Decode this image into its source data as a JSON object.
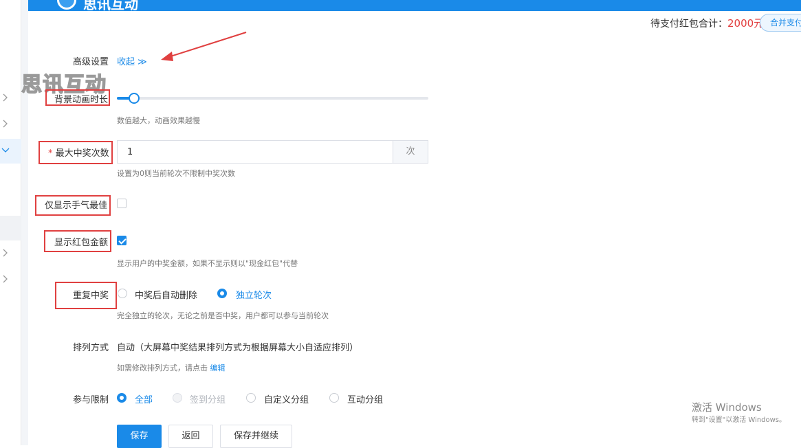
{
  "header": {
    "logo_text": "思讯互动",
    "pay_label": "待支付红包合计：",
    "pay_amount": "2000元",
    "merge_button": "合并支付"
  },
  "watermark": "思讯互动",
  "advanced": {
    "label": "高级设置",
    "toggle": "收起 ≫"
  },
  "bg_anim": {
    "label": "背景动画时长",
    "slider_fraction": 0.05,
    "hint": "数值越大，动画效果越慢"
  },
  "max_win": {
    "required_mark": "*",
    "label": "最大中奖次数",
    "value": "1",
    "suffix": "次",
    "hint": "设置为0则当前轮次不限制中奖次数"
  },
  "best_luck": {
    "label": "仅显示手气最佳",
    "checked": false
  },
  "show_amount": {
    "label": "显示红包金额",
    "checked": true,
    "hint": "显示用户的中奖金额，如果不显示则以\"现金红包\"代替"
  },
  "repeat_win": {
    "label": "重复中奖",
    "options": [
      "中奖后自动删除",
      "独立轮次"
    ],
    "selected": 1,
    "hint": "完全独立的轮次，无论之前是否中奖，用户都可以参与当前轮次"
  },
  "sort": {
    "label": "排列方式",
    "value": "自动（大屏幕中奖结果排列方式为根据屏幕大小自适应排列）",
    "hint_prefix": "如需修改排列方式，请点击",
    "hint_link": "编辑"
  },
  "limit": {
    "label": "参与限制",
    "options": [
      "全部",
      "签到分组",
      "自定义分组",
      "互动分组"
    ],
    "selected": 0
  },
  "buttons": {
    "save": "保存",
    "back": "返回",
    "save_continue": "保存并继续"
  },
  "windows": {
    "title": "激活 Windows",
    "sub": "转到\"设置\"以激活 Windows。"
  },
  "colors": {
    "primary": "#1a8ae8",
    "amount_red": "#e23d3d",
    "annotation_red": "#e04040"
  }
}
